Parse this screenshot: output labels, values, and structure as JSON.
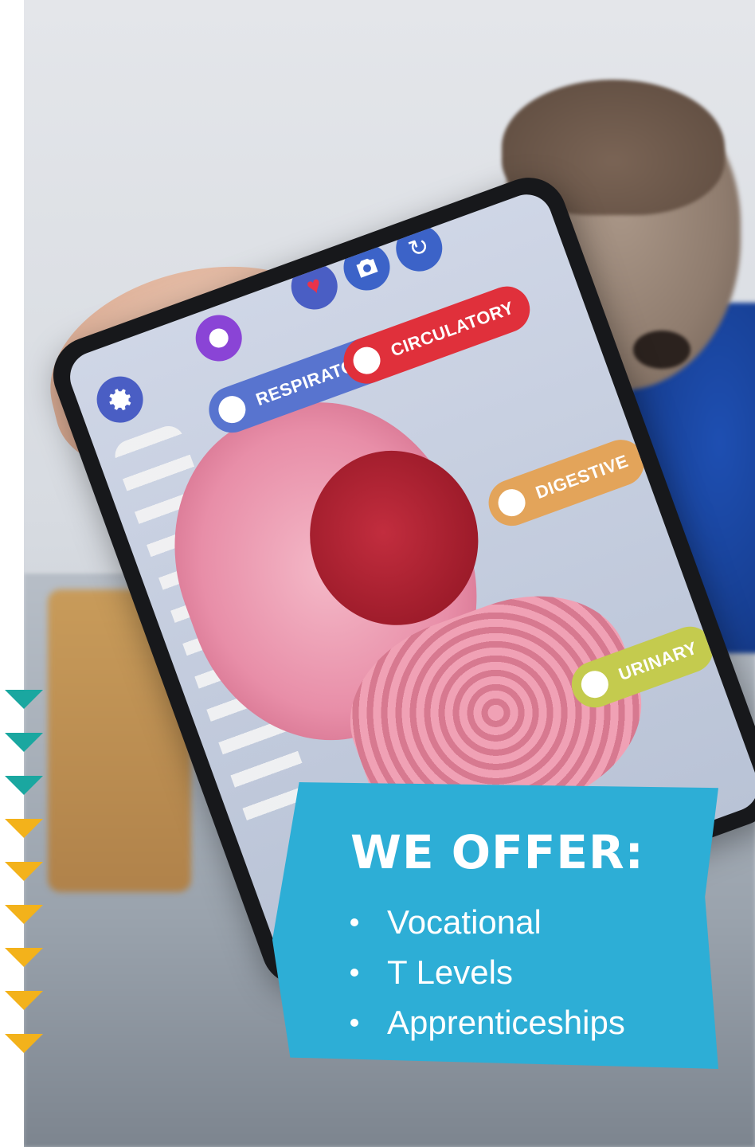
{
  "screen_labels": {
    "respiratory": "RESPIRATORY",
    "circulatory": "CIRCULATORY",
    "digestive": "DIGESTIVE",
    "urinary": "URINARY"
  },
  "offer": {
    "title": "WE OFFER:",
    "items": [
      "Vocational",
      "T Levels",
      "Apprenticeships"
    ]
  },
  "icons": [
    "gear-icon",
    "heart-pulse-icon",
    "camera-icon",
    "rotate-camera-icon",
    "record-icon"
  ],
  "colors": {
    "offer_bg": "#2daed6",
    "marker_teal": "#1aa7a0",
    "marker_yellow": "#f3b21b",
    "tag_respiratory": "#5874cf",
    "tag_circulatory": "#e0303b",
    "tag_digestive": "#e3a45a",
    "tag_urinary": "#c4cb4e"
  }
}
